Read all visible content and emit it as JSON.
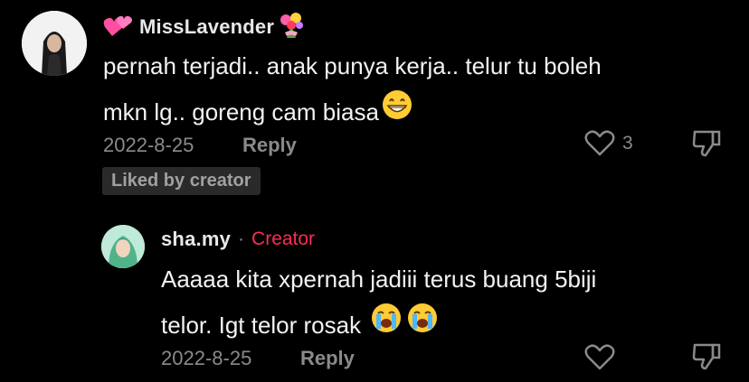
{
  "comments": [
    {
      "username": "MissLavender",
      "prefix_icon": "hearts-emoji",
      "suffix_icon": "bouquet-emoji",
      "text_line1": "pernah terjadi.. anak punya kerja.. telur tu boleh",
      "text_line2": "mkn lg.. goreng cam biasa",
      "text_emoji": "grin-emoji",
      "date": "2022-8-25",
      "reply_label": "Reply",
      "like_count": "3",
      "badge": "Liked by creator"
    },
    {
      "username": "sha.my",
      "separator": "·",
      "creator_label": "Creator",
      "text_line1": "Aaaaa kita xpernah jadiii terus buang 5biji",
      "text_line2": "telor. Igt telor rosak",
      "text_emojis": [
        "crying-emoji",
        "crying-emoji"
      ],
      "date": "2022-8-25",
      "reply_label": "Reply"
    }
  ],
  "colors": {
    "background": "#000000",
    "creator_accent": "#fe2c55",
    "muted": "#8a8a8a"
  }
}
